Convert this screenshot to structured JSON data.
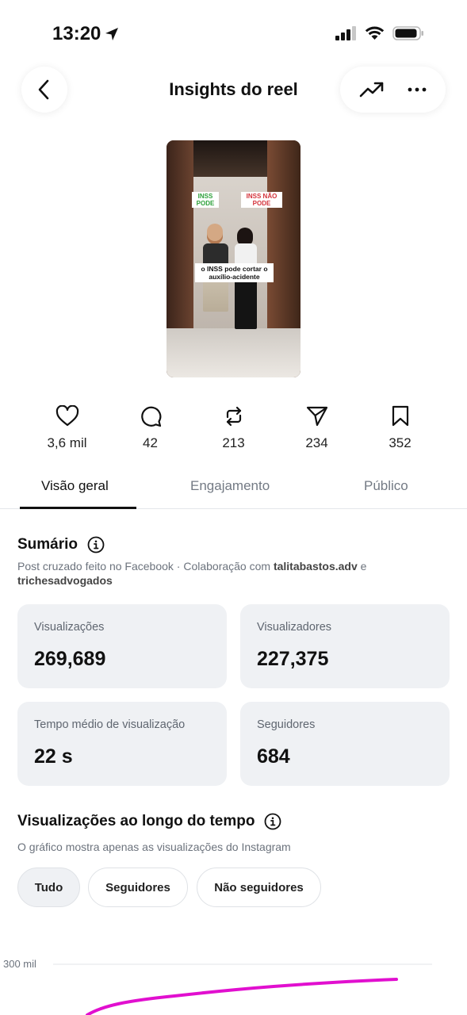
{
  "status_bar": {
    "time": "13:20"
  },
  "header": {
    "title": "Insights do reel"
  },
  "thumbnail": {
    "tag_left": "INSS PODE",
    "tag_right": "INSS NÃO PODE",
    "caption": "o INSS pode cortar o auxílio-acidente"
  },
  "stats": {
    "likes": "3,6 mil",
    "comments": "42",
    "reposts": "213",
    "shares": "234",
    "saves": "352"
  },
  "tabs": [
    "Visão geral",
    "Engajamento",
    "Público"
  ],
  "summary": {
    "title": "Sumário",
    "desc_prefix": "Post cruzado feito no Facebook · Colaboração com ",
    "collab1": "talitabastos.adv",
    "desc_and": " e",
    "collab2": "trichesadvogados",
    "cards": [
      {
        "label": "Visualizações",
        "value": "269,689"
      },
      {
        "label": "Visualizadores",
        "value": "227,375"
      },
      {
        "label": "Tempo médio de visualização",
        "value": "22 s"
      },
      {
        "label": "Seguidores",
        "value": "684"
      }
    ]
  },
  "views_over_time": {
    "title": "Visualizações ao longo do tempo",
    "subtitle": "O gráfico mostra apenas as visualizações do Instagram",
    "filters": [
      "Tudo",
      "Seguidores",
      "Não seguidores"
    ],
    "active_filter": "Tudo"
  },
  "chart_data": {
    "type": "line",
    "y_ticks": [
      "300 mil"
    ],
    "series": [
      {
        "color": "#e10fcf"
      }
    ]
  },
  "colors": {
    "accent_line": "#e10fcf",
    "card_bg": "#eff1f4"
  }
}
